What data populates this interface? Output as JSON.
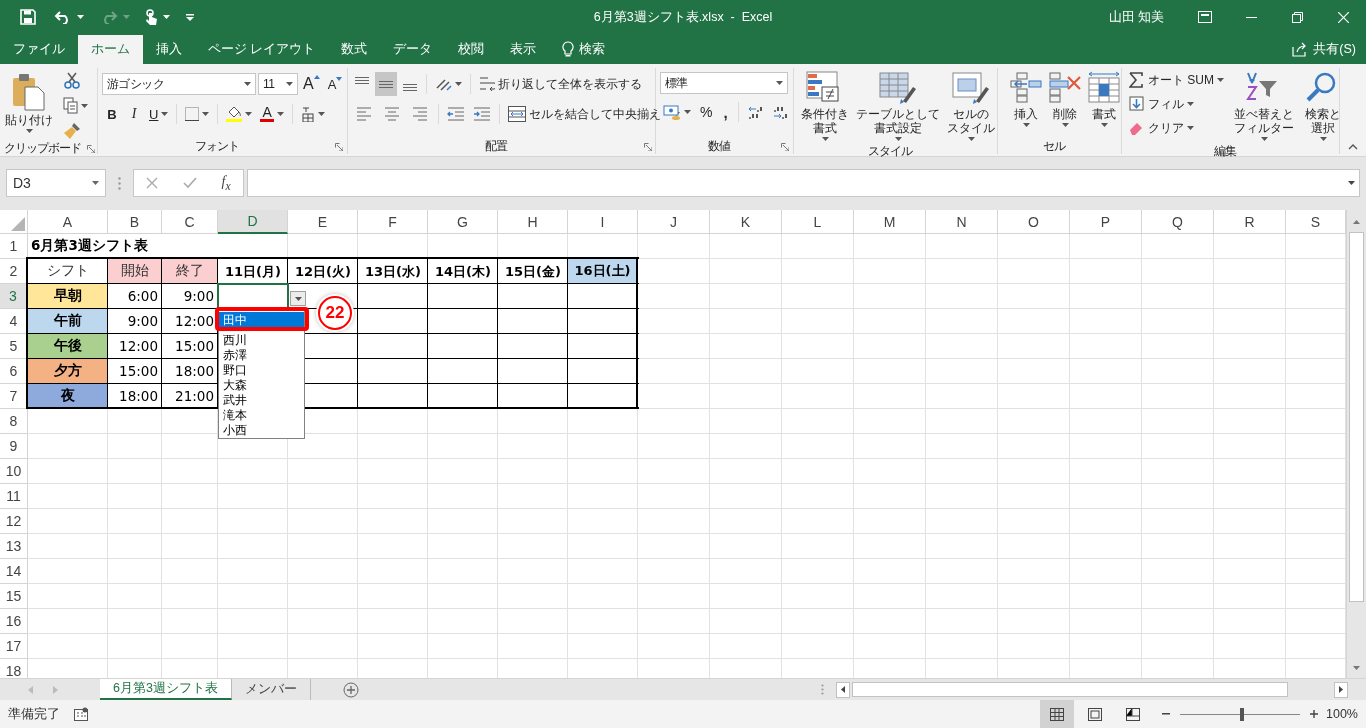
{
  "title_bar": {
    "document_title": "6月第3週シフト表.xlsx  -  Excel",
    "user": "山田 知美"
  },
  "ribbon_tabs": [
    {
      "kind": "tab",
      "label": "ファイル",
      "selected": false
    },
    {
      "kind": "tab",
      "label": "ホーム",
      "selected": true
    },
    {
      "kind": "tab",
      "label": "挿入",
      "selected": false
    },
    {
      "kind": "tab",
      "label": "ページ レイアウト",
      "selected": false
    },
    {
      "kind": "tab",
      "label": "数式",
      "selected": false
    },
    {
      "kind": "tab",
      "label": "データ",
      "selected": false
    },
    {
      "kind": "tab",
      "label": "校閲",
      "selected": false
    },
    {
      "kind": "tab",
      "label": "表示",
      "selected": false
    },
    {
      "kind": "search",
      "label": "検索",
      "selected": false
    }
  ],
  "share": "共有(S)",
  "ribbon": {
    "clipboard": {
      "paste": "貼り付け",
      "label": "クリップボード"
    },
    "font": {
      "font_name": "游ゴシック",
      "font_size": "11",
      "grow": "A",
      "shrink": "A",
      "bold": "B",
      "italic": "I",
      "underline": "U",
      "font_color": "A",
      "label": "フォント"
    },
    "alignment": {
      "vertical": [
        {
          "kind": "top",
          "selected": false
        },
        {
          "kind": "middle",
          "selected": true
        },
        {
          "kind": "bottom",
          "selected": false
        }
      ],
      "wrap_text": "折り返して全体を表示する",
      "merge_center": "セルを結合して中央揃え",
      "label": "配置"
    },
    "number": {
      "format": "標準",
      "percent": "%",
      "comma": ",",
      "label": "数値"
    },
    "styles": {
      "buttons": [
        {
          "kind": "conditional",
          "lines": [
            "条件付き",
            "書式"
          ]
        },
        {
          "kind": "table",
          "lines": [
            "テーブルとして",
            "書式設定"
          ]
        },
        {
          "kind": "cell_style",
          "lines": [
            "セルの",
            "スタイル"
          ]
        }
      ],
      "label": "スタイル"
    },
    "cells": {
      "buttons": [
        {
          "kind": "insert",
          "label": "挿入"
        },
        {
          "kind": "delete",
          "label": "削除"
        },
        {
          "kind": "format",
          "label": "書式"
        }
      ],
      "label": "セル"
    },
    "editing": {
      "small": [
        {
          "kind": "autosum",
          "label": "オート SUM"
        },
        {
          "kind": "fill",
          "label": "フィル"
        },
        {
          "kind": "clear",
          "label": "クリア"
        }
      ],
      "large": [
        {
          "kind": "sort",
          "lines": [
            "並べ替えと",
            "フィルター"
          ]
        },
        {
          "kind": "find",
          "lines": [
            "検索と",
            "選択"
          ]
        }
      ],
      "label": "編集"
    }
  },
  "formula_bar": {
    "name_box": "D3",
    "insert_function": "f$_{x}$"
  },
  "sheet": {
    "columns": [
      {
        "label": "A",
        "selected": false
      },
      {
        "label": "B",
        "selected": false
      },
      {
        "label": "C",
        "selected": false
      },
      {
        "label": "D",
        "selected": true
      },
      {
        "label": "E",
        "selected": false
      },
      {
        "label": "F",
        "selected": false
      },
      {
        "label": "G",
        "selected": false
      },
      {
        "label": "H",
        "selected": false
      },
      {
        "label": "I",
        "selected": false
      },
      {
        "label": "J",
        "selected": false
      },
      {
        "label": "K",
        "selected": false
      },
      {
        "label": "L",
        "selected": false
      },
      {
        "label": "M",
        "selected": false
      },
      {
        "label": "N",
        "selected": false
      },
      {
        "label": "O",
        "selected": false
      },
      {
        "label": "P",
        "selected": false
      },
      {
        "label": "Q",
        "selected": false
      },
      {
        "label": "R",
        "selected": false
      },
      {
        "label": "S",
        "selected": false
      }
    ],
    "rows": [
      {
        "label": "1",
        "selected": false,
        "cells": [
          {
            "kind": "title",
            "text": "6月第3週シフト表"
          }
        ]
      },
      {
        "label": "2",
        "selected": false,
        "cells": [
          {
            "kind": "label",
            "text": "シフト"
          },
          {
            "kind": "label",
            "text": "開始",
            "color": "#fbcfd0"
          },
          {
            "kind": "label",
            "text": "終了",
            "color": "#fbcfd0"
          },
          {
            "kind": "day",
            "text": "11日(月)"
          },
          {
            "kind": "day",
            "text": "12日(火)"
          },
          {
            "kind": "day",
            "text": "13日(水)"
          },
          {
            "kind": "day",
            "text": "14日(木)"
          },
          {
            "kind": "day",
            "text": "15日(金)"
          },
          {
            "kind": "day",
            "text": "16日(土)",
            "color": "#bdd7ee"
          }
        ]
      },
      {
        "label": "3",
        "selected": true,
        "cells": [
          {
            "kind": "shift",
            "text": "早朝",
            "color": "#ffe699"
          },
          {
            "kind": "time",
            "text": "6:00"
          },
          {
            "kind": "time",
            "text": "9:00"
          },
          {
            "kind": "empty"
          },
          {
            "kind": "empty"
          },
          {
            "kind": "empty"
          },
          {
            "kind": "empty"
          },
          {
            "kind": "empty"
          },
          {
            "kind": "empty"
          }
        ]
      },
      {
        "label": "4",
        "selected": false,
        "cells": [
          {
            "kind": "shift",
            "text": "午前",
            "color": "#bdd7ee"
          },
          {
            "kind": "time",
            "text": "9:00"
          },
          {
            "kind": "time",
            "text": "12:00"
          },
          {
            "kind": "empty"
          },
          {
            "kind": "empty"
          },
          {
            "kind": "empty"
          },
          {
            "kind": "empty"
          },
          {
            "kind": "empty"
          },
          {
            "kind": "empty"
          }
        ]
      },
      {
        "label": "5",
        "selected": false,
        "cells": [
          {
            "kind": "shift",
            "text": "午後",
            "color": "#a9d08e"
          },
          {
            "kind": "time",
            "text": "12:00"
          },
          {
            "kind": "time",
            "text": "15:00"
          },
          {
            "kind": "empty"
          },
          {
            "kind": "empty"
          },
          {
            "kind": "empty"
          },
          {
            "kind": "empty"
          },
          {
            "kind": "empty"
          },
          {
            "kind": "empty"
          }
        ]
      },
      {
        "label": "6",
        "selected": false,
        "cells": [
          {
            "kind": "shift",
            "text": "夕方",
            "color": "#f4b183"
          },
          {
            "kind": "time",
            "text": "15:00"
          },
          {
            "kind": "time",
            "text": "18:00"
          },
          {
            "kind": "empty"
          },
          {
            "kind": "empty"
          },
          {
            "kind": "empty"
          },
          {
            "kind": "empty"
          },
          {
            "kind": "empty"
          },
          {
            "kind": "empty"
          }
        ]
      },
      {
        "label": "7",
        "selected": false,
        "cells": [
          {
            "kind": "shift",
            "text": "夜",
            "color": "#8ea9db"
          },
          {
            "kind": "time",
            "text": "18:00"
          },
          {
            "kind": "time",
            "text": "21:00"
          },
          {
            "kind": "empty"
          },
          {
            "kind": "empty"
          },
          {
            "kind": "empty"
          },
          {
            "kind": "empty"
          },
          {
            "kind": "empty"
          },
          {
            "kind": "empty"
          }
        ]
      },
      {
        "label": "8",
        "selected": false
      },
      {
        "label": "9",
        "selected": false
      },
      {
        "label": "10",
        "selected": false
      },
      {
        "label": "11",
        "selected": false
      },
      {
        "label": "12",
        "selected": false
      },
      {
        "label": "13",
        "selected": false
      },
      {
        "label": "14",
        "selected": false
      },
      {
        "label": "15",
        "selected": false
      },
      {
        "label": "16",
        "selected": false
      },
      {
        "label": "17",
        "selected": false
      },
      {
        "label": "18",
        "selected": false
      }
    ],
    "validation_list": [
      {
        "label": "田中",
        "selected": true
      },
      {
        "label": "西川",
        "selected": false
      },
      {
        "label": "赤澤",
        "selected": false
      },
      {
        "label": "野口",
        "selected": false
      },
      {
        "label": "大森",
        "selected": false
      },
      {
        "label": "武井",
        "selected": false
      },
      {
        "label": "滝本",
        "selected": false
      },
      {
        "label": "小西",
        "selected": false
      }
    ],
    "annotation": "22"
  },
  "sheet_tabs": [
    {
      "label": "6月第3週シフト表",
      "selected": true
    },
    {
      "label": "メンバー",
      "selected": false
    }
  ],
  "status_bar": {
    "status": "準備完了",
    "views": [
      {
        "kind": "normal",
        "selected": true
      },
      {
        "kind": "page_layout",
        "selected": false
      },
      {
        "kind": "page_break",
        "selected": false
      }
    ],
    "zoom": {
      "level": 0.52
    },
    "zoom_reading": "100%"
  }
}
